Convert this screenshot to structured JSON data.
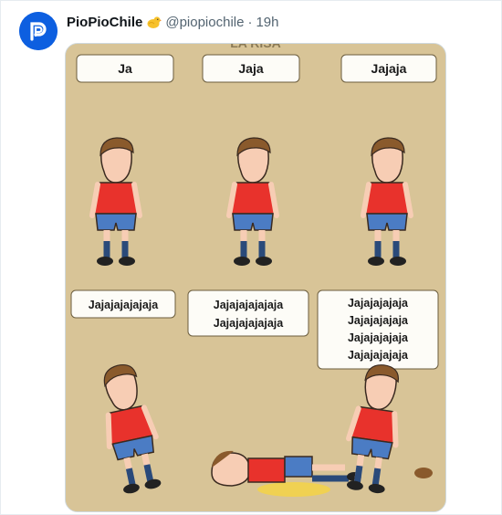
{
  "tweet": {
    "author_name": "PioPioChile",
    "author_handle": "@piopiochile",
    "separator": "·",
    "timestamp": "19h",
    "avatar_icon": "piopio-logo-icon",
    "badge_icon": "chick-icon",
    "accent_color": "#0d5fe0"
  },
  "meme": {
    "panels": [
      {
        "lines": [
          "Ja"
        ]
      },
      {
        "lines": [
          "Jaja"
        ]
      },
      {
        "lines": [
          "Jajaja"
        ]
      },
      {
        "lines": [
          "Jajajajajajaja"
        ]
      },
      {
        "lines": [
          "Jajajajajajaja",
          "Jajajajajajaja"
        ]
      },
      {
        "lines": [
          "Jajajajajaja",
          "Jajajajajaja",
          "Jajajajajaja",
          "Jajajajajaja"
        ]
      }
    ]
  }
}
